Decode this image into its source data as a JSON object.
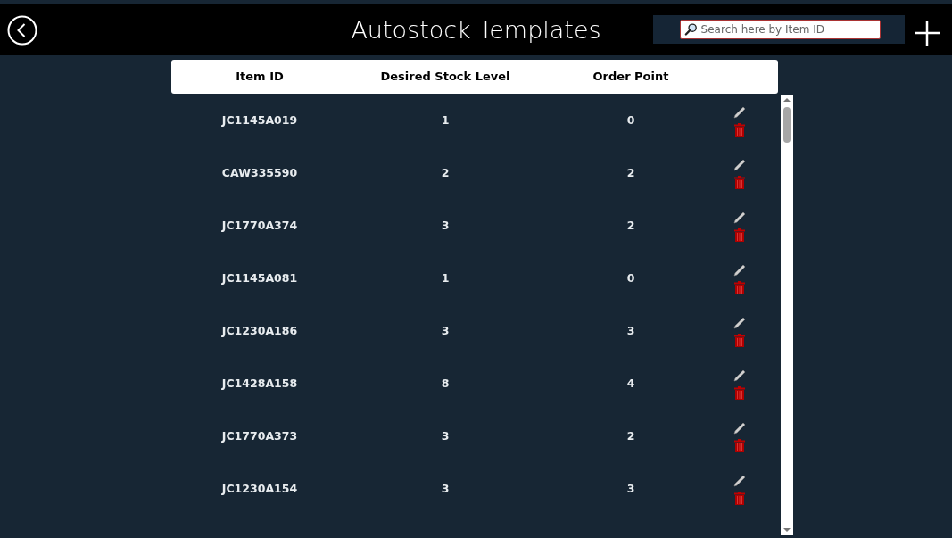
{
  "header": {
    "title": "Autostock Templates"
  },
  "search": {
    "placeholder": "Search here by Item ID"
  },
  "table": {
    "columns": [
      "Item ID",
      "Desired Stock Level",
      "Order Point"
    ],
    "rows": [
      {
        "item_id": "JC1145A019",
        "desired_stock_level": "1",
        "order_point": "0"
      },
      {
        "item_id": "CAW335590",
        "desired_stock_level": "2",
        "order_point": "2"
      },
      {
        "item_id": "JC1770A374",
        "desired_stock_level": "3",
        "order_point": "2"
      },
      {
        "item_id": "JC1145A081",
        "desired_stock_level": "1",
        "order_point": "0"
      },
      {
        "item_id": "JC1230A186",
        "desired_stock_level": "3",
        "order_point": "3"
      },
      {
        "item_id": "JC1428A158",
        "desired_stock_level": "8",
        "order_point": "4"
      },
      {
        "item_id": "JC1770A373",
        "desired_stock_level": "3",
        "order_point": "2"
      },
      {
        "item_id": "JC1230A154",
        "desired_stock_level": "3",
        "order_point": "3"
      }
    ]
  }
}
